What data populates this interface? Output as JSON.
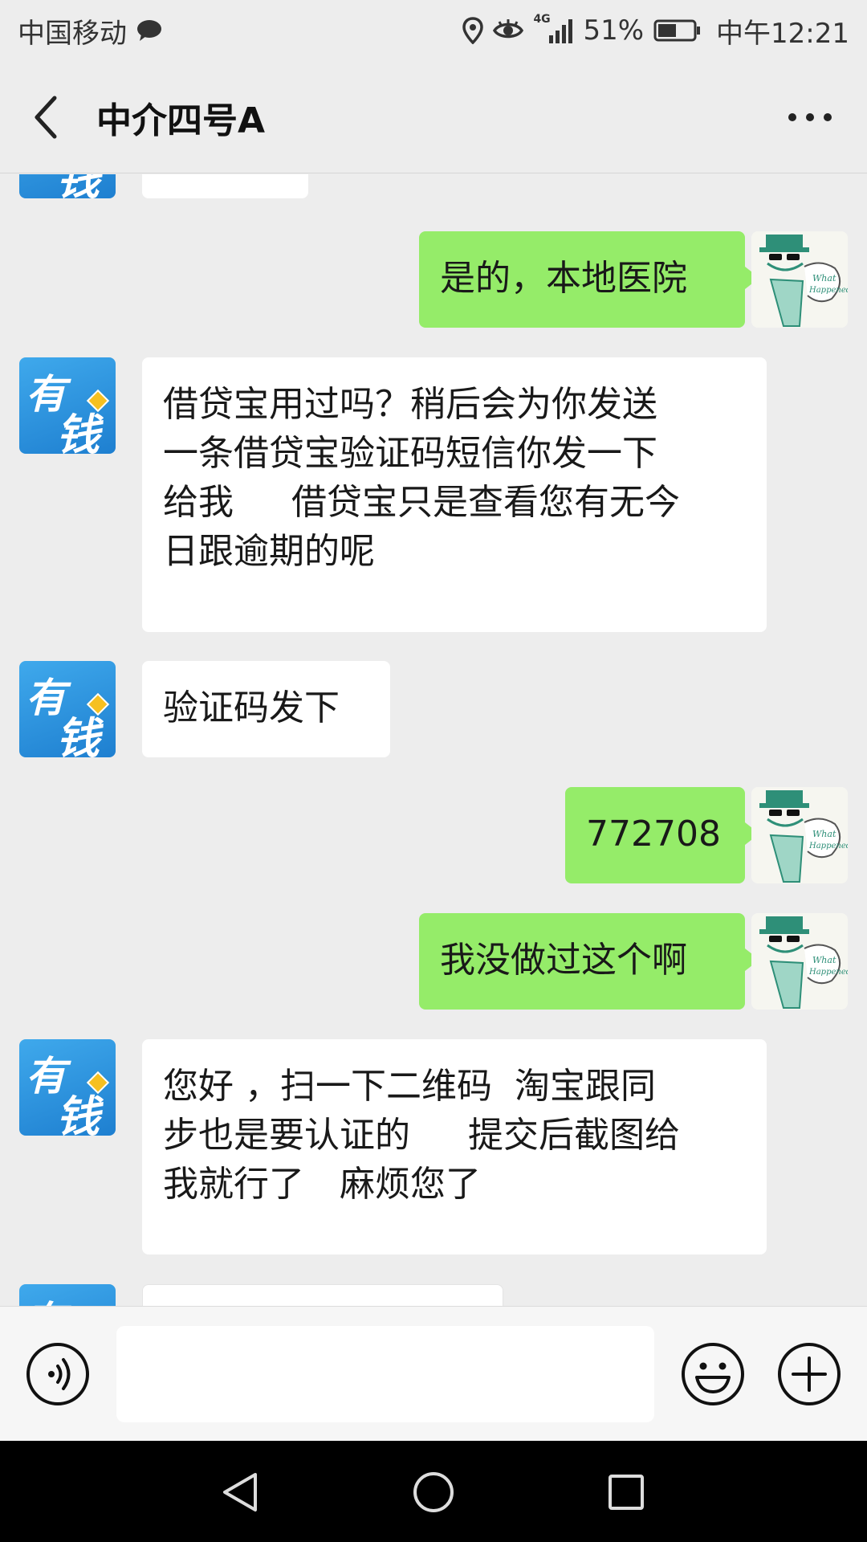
{
  "status_bar": {
    "carrier": "中国移动",
    "network": "4G",
    "battery": "51%",
    "time": "中午12:21"
  },
  "header": {
    "title": "中介四号A"
  },
  "messages": [
    {
      "side": "left",
      "sender": "有钱",
      "text": "",
      "partial": true
    },
    {
      "side": "right",
      "text": "是的，本地医院"
    },
    {
      "side": "left",
      "sender": "有钱",
      "text": "借贷宝用过吗？稍后会为你发送\n一条借贷宝验证码短信你发一下\n给我　  借贷宝只是查看您有无今\n日跟逾期的呢"
    },
    {
      "side": "left",
      "sender": "有钱",
      "text": "验证码发下"
    },
    {
      "side": "right",
      "text": "772708"
    },
    {
      "side": "right",
      "text": "我没做过这个啊"
    },
    {
      "side": "left",
      "sender": "有钱",
      "text": "您好 ，扫一下二维码  淘宝跟同\n步也是要认证的　  提交后截图给\n我就行了　麻烦您了"
    }
  ],
  "avatars": {
    "left": {
      "top": "有",
      "bottom": "钱"
    },
    "right": {
      "caption": "What Happened?"
    }
  },
  "input": {
    "value": ""
  },
  "colors": {
    "sent_bubble": "#95ec69",
    "received_bubble": "#ffffff",
    "background": "#ededed",
    "brand_avatar": "#2a8ddc"
  }
}
